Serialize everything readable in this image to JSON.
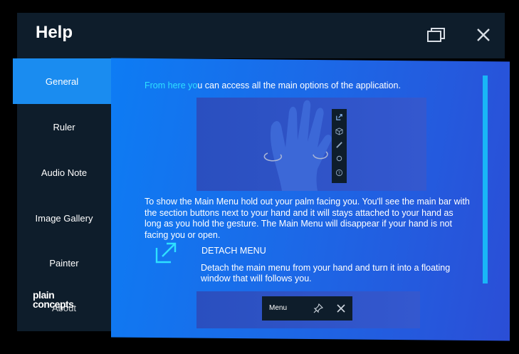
{
  "window": {
    "title": "Help"
  },
  "sidebar": {
    "items": [
      {
        "label": "General"
      },
      {
        "label": "Ruler"
      },
      {
        "label": "Audio Note"
      },
      {
        "label": "Image Gallery"
      },
      {
        "label": "Painter"
      },
      {
        "label": "About"
      }
    ],
    "logo": {
      "line1": "plain",
      "line2": "concepts"
    }
  },
  "content": {
    "intro": "From here you can access all the main options of the application.",
    "main_menu_text": "To show the Main Menu hold out your  palm facing you. You'll see the main bar with the section buttons next to your hand and it will stays attached to your hand as long as you hold the gesture. The Main Menu will disappear if your hand is not facing you or open.",
    "detach_heading": "DETACH MENU",
    "detach_text": "Detach the main menu from your hand and turn it into a floating window that will follows you.",
    "menu_preview_label": "Menu"
  },
  "colors": {
    "accent": "#1a8cf0",
    "highlight": "#2ee0ff",
    "panel": "#0e1d2b",
    "scroll": "#19b6f7"
  }
}
